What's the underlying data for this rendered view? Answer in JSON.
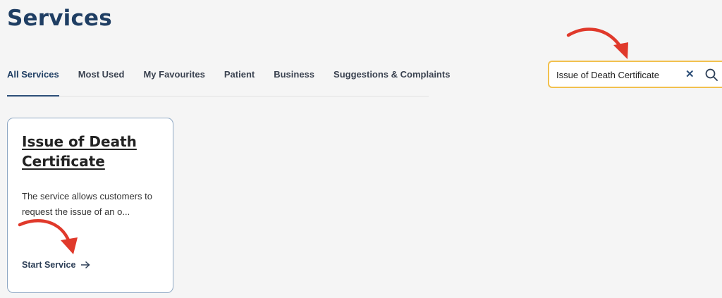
{
  "header": {
    "title": "Services"
  },
  "tabs": [
    {
      "label": "All Services",
      "active": true
    },
    {
      "label": "Most Used",
      "active": false
    },
    {
      "label": "My Favourites",
      "active": false
    },
    {
      "label": "Patient",
      "active": false
    },
    {
      "label": "Business",
      "active": false
    },
    {
      "label": "Suggestions & Complaints",
      "active": false
    }
  ],
  "search": {
    "value": "Issue of Death Certificate",
    "clear_icon": "close-icon",
    "search_icon": "search-icon"
  },
  "card": {
    "title": "Issue of Death Certificate",
    "description": "The service allows customers to request the issue of an o...",
    "action_label": "Start Service",
    "action_icon": "arrow-right-icon"
  },
  "colors": {
    "brand": "#1f3e63",
    "search_border": "#f2c14e",
    "annotation_arrow": "#e0392b"
  }
}
